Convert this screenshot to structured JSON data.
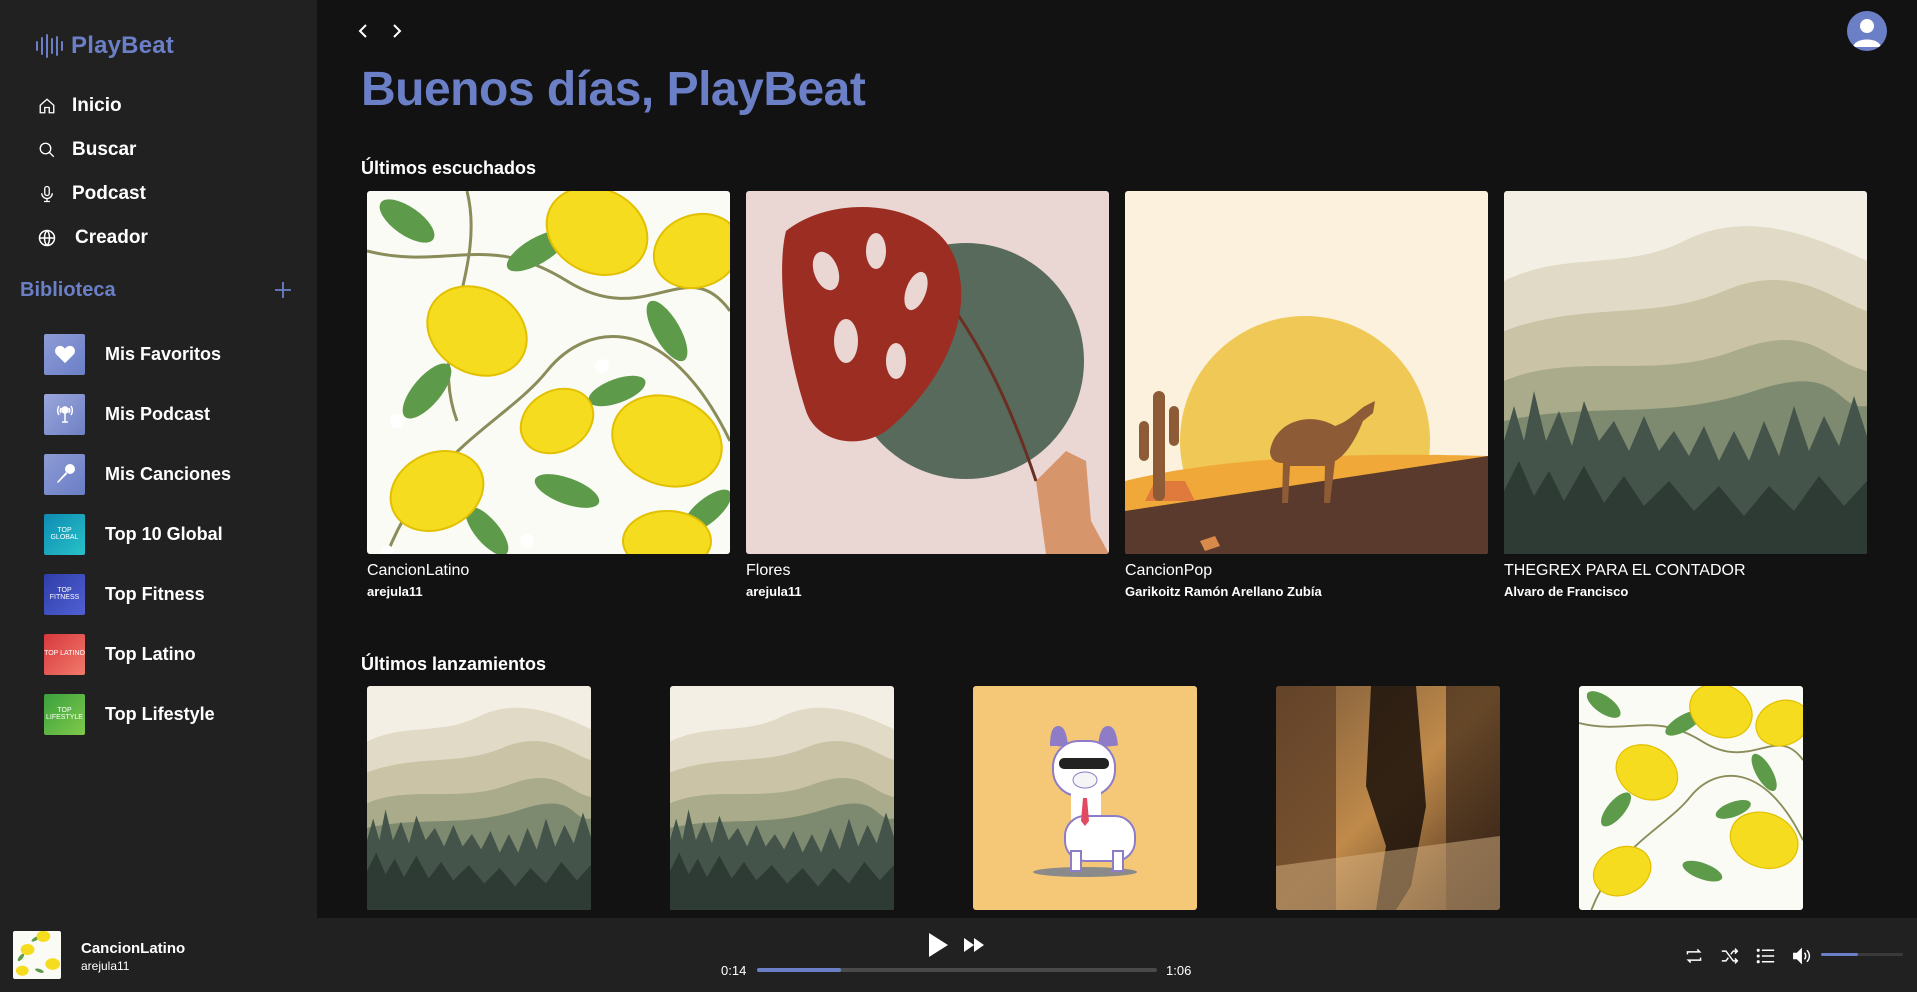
{
  "app": {
    "logo_text": "PlayBeat",
    "accent_color": "#6b7fc7"
  },
  "sidebar": {
    "nav": [
      {
        "label": "Inicio",
        "icon": "home-icon"
      },
      {
        "label": "Buscar",
        "icon": "search-icon"
      },
      {
        "label": "Podcast",
        "icon": "microphone-icon"
      },
      {
        "label": "Creador",
        "icon": "globe-icon"
      }
    ],
    "library": {
      "title": "Biblioteca",
      "add_icon": "plus-icon",
      "items": [
        {
          "label": "Mis Favoritos",
          "icon": "heart-icon"
        },
        {
          "label": "Mis Podcast",
          "icon": "podcast-icon"
        },
        {
          "label": "Mis Canciones",
          "icon": "microphone-icon"
        },
        {
          "label": "Top 10 Global",
          "thumb_text": "TOP GLOBAL"
        },
        {
          "label": "Top Fitness",
          "thumb_text": "TOP FITNESS"
        },
        {
          "label": "Top Latino",
          "thumb_text": "TOP LATINO"
        },
        {
          "label": "Top Lifestyle",
          "thumb_text": "TOP LIFESTYLE"
        }
      ]
    }
  },
  "main": {
    "greeting": "Buenos días, PlayBeat",
    "recent": {
      "title": "Últimos escuchados",
      "items": [
        {
          "title": "CancionLatino",
          "artist": "arejula11",
          "art": "lemons"
        },
        {
          "title": "Flores",
          "artist": "arejula11",
          "art": "monstera"
        },
        {
          "title": "CancionPop",
          "artist": "Garikoitz Ramón Arellano Zubía",
          "art": "desert-camel"
        },
        {
          "title": "THEGREX PARA EL CONTADOR",
          "artist": "Alvaro de Francisco",
          "art": "misty-mountains"
        }
      ]
    },
    "releases": {
      "title": "Últimos lanzamientos",
      "items": [
        {
          "art": "misty-mountains"
        },
        {
          "art": "misty-mountains"
        },
        {
          "art": "llama"
        },
        {
          "art": "dancer"
        },
        {
          "art": "lemons"
        }
      ]
    }
  },
  "player": {
    "title": "CancionLatino",
    "artist": "arejula11",
    "current_time": "0:14",
    "total_time": "1:06",
    "progress": 0.21,
    "volume": 0.45
  }
}
